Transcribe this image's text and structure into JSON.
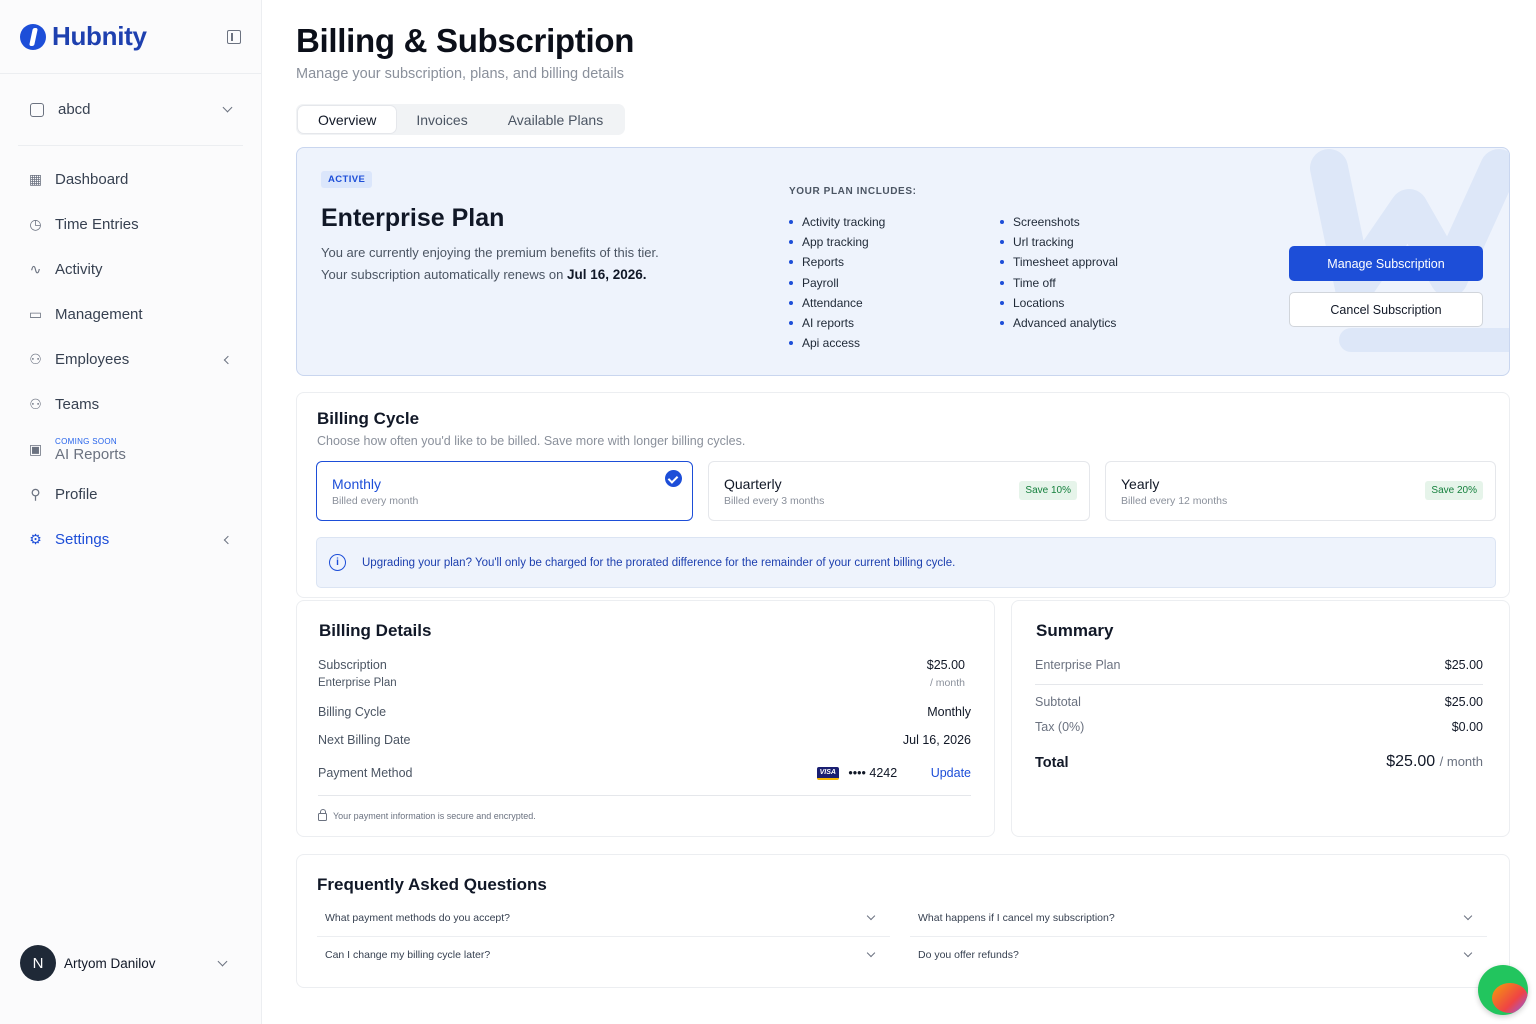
{
  "brand": {
    "name": "Hubnity"
  },
  "workspace": {
    "name": "abcd"
  },
  "nav": {
    "dashboard": "Dashboard",
    "time_entries": "Time Entries",
    "activity": "Activity",
    "management": "Management",
    "employees": "Employees",
    "teams": "Teams",
    "ai_reports_tag": "COMING SOON",
    "ai_reports": "AI Reports",
    "profile": "Profile",
    "settings": "Settings"
  },
  "user": {
    "initial": "N",
    "name": "Artyom Danilov"
  },
  "page": {
    "title": "Billing & Subscription",
    "subtitle": "Manage your subscription, plans, and billing details"
  },
  "tabs": [
    "Overview",
    "Invoices",
    "Available Plans"
  ],
  "plan": {
    "status": "ACTIVE",
    "name": "Enterprise Plan",
    "desc_line1": "You are currently enjoying the premium benefits of this tier.",
    "desc_line2_prefix": "Your subscription automatically renews on ",
    "renew_date": "Jul 16, 2026.",
    "includes_title": "YOUR PLAN INCLUDES:",
    "features_col1": [
      "Activity tracking",
      "App tracking",
      "Reports",
      "Payroll",
      "Attendance",
      "AI reports",
      "Api access"
    ],
    "features_col2": [
      "Screenshots",
      "Url tracking",
      "Timesheet approval",
      "Time off",
      "Locations",
      "Advanced analytics"
    ],
    "manage_label": "Manage Subscription",
    "cancel_label": "Cancel Subscription"
  },
  "billing_cycle": {
    "title": "Billing Cycle",
    "subtitle": "Choose how often you'd like to be billed. Save more with longer billing cycles.",
    "options": [
      {
        "title": "Monthly",
        "sub": "Billed every month",
        "save": "",
        "selected": true
      },
      {
        "title": "Quarterly",
        "sub": "Billed every 3 months",
        "save": "Save 10%",
        "selected": false
      },
      {
        "title": "Yearly",
        "sub": "Billed every 12 months",
        "save": "Save 20%",
        "selected": false
      }
    ],
    "info": "Upgrading your plan? You'll only be charged for the prorated difference for the remainder of your current billing cycle."
  },
  "billing_details": {
    "title": "Billing Details",
    "subscription_label": "Subscription",
    "subscription_plan": "Enterprise Plan",
    "subscription_price": "$25.00",
    "subscription_unit": "/ month",
    "cycle_label": "Billing Cycle",
    "cycle_value": "Monthly",
    "next_label": "Next Billing Date",
    "next_value": "Jul 16, 2026",
    "payment_label": "Payment Method",
    "card_brand": "VISA",
    "card_masked": "•••• 4242",
    "update_label": "Update",
    "secure_note": "Your payment information is secure and encrypted."
  },
  "summary": {
    "title": "Summary",
    "plan_label": "Enterprise Plan",
    "plan_value": "$25.00",
    "subtotal_label": "Subtotal",
    "subtotal_value": "$25.00",
    "tax_label": "Tax (0%)",
    "tax_value": "$0.00",
    "total_label": "Total",
    "total_value": "$25.00",
    "total_unit": "/ month"
  },
  "faq": {
    "title": "Frequently Asked Questions",
    "q1": "What payment methods do you accept?",
    "q2": "What happens if I cancel my subscription?",
    "q3": "Can I change my billing cycle later?",
    "q4": "Do you offer refunds?"
  },
  "colors": {
    "accent": "#1d4ed8",
    "plan_bg": "#eef3fc",
    "save_badge": "#15803d"
  }
}
